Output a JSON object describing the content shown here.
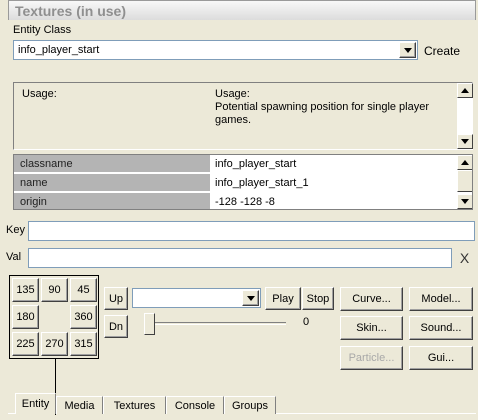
{
  "panel": {
    "title": "Textures (in use)"
  },
  "entity_class": {
    "label": "Entity Class",
    "value": "info_player_start",
    "create_label": "Create"
  },
  "usage": {
    "left_label": "Usage:",
    "right_title": "Usage:",
    "right_text": "Potential spawning position for single player games."
  },
  "properties": [
    {
      "key": "classname",
      "value": "info_player_start"
    },
    {
      "key": "name",
      "value": "info_player_start_1"
    },
    {
      "key": "origin",
      "value": "-128 -128 -8"
    }
  ],
  "key_field": {
    "label": "Key",
    "value": ""
  },
  "val_field": {
    "label": "Val",
    "value": "",
    "clear_label": "X"
  },
  "angles": [
    "135",
    "90",
    "45",
    "180",
    "360",
    "225",
    "270",
    "315"
  ],
  "controls": {
    "up_label": "Up",
    "dn_label": "Dn",
    "anim_value": "",
    "play_label": "Play",
    "stop_label": "Stop",
    "slider_value": "0",
    "slider_fraction": 0
  },
  "side_buttons": {
    "curve": "Curve...",
    "model": "Model...",
    "skin": "Skin...",
    "sound": "Sound...",
    "particle": "Particle...",
    "gui": "Gui..."
  },
  "tabs": [
    "Entity",
    "Media",
    "Textures",
    "Console",
    "Groups"
  ],
  "active_tab": "Entity"
}
